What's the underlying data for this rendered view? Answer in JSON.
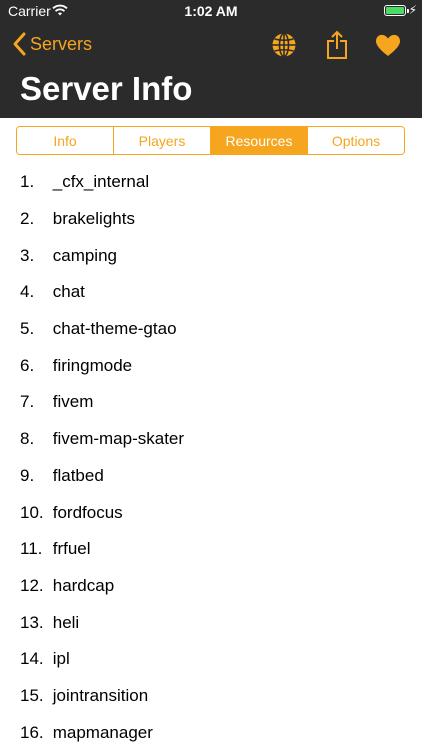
{
  "status_bar": {
    "carrier": "Carrier",
    "time": "1:02 AM",
    "battery_level_fraction": 1.0
  },
  "nav": {
    "back_label": "Servers",
    "title": "Server Info",
    "icons": [
      "globe-icon",
      "share-icon",
      "heart-icon"
    ]
  },
  "colors": {
    "accent": "#f5a51e",
    "bar_bg": "#2b2b2b",
    "text": "#000000",
    "battery": "#4cd964"
  },
  "tabs": [
    {
      "label": "Info",
      "active": false
    },
    {
      "label": "Players",
      "active": false
    },
    {
      "label": "Resources",
      "active": true
    },
    {
      "label": "Options",
      "active": false
    }
  ],
  "resources": [
    {
      "num": "1.",
      "name": "_cfx_internal"
    },
    {
      "num": "2.",
      "name": "brakelights"
    },
    {
      "num": "3.",
      "name": "camping"
    },
    {
      "num": "4.",
      "name": "chat"
    },
    {
      "num": "5.",
      "name": "chat-theme-gtao"
    },
    {
      "num": "6.",
      "name": "firingmode"
    },
    {
      "num": "7.",
      "name": "fivem"
    },
    {
      "num": "8.",
      "name": "fivem-map-skater"
    },
    {
      "num": "9.",
      "name": "flatbed"
    },
    {
      "num": "10.",
      "name": "fordfocus"
    },
    {
      "num": "11.",
      "name": "frfuel"
    },
    {
      "num": "12.",
      "name": "hardcap"
    },
    {
      "num": "13.",
      "name": "heli"
    },
    {
      "num": "14.",
      "name": "ipl"
    },
    {
      "num": "15.",
      "name": "jointransition"
    },
    {
      "num": "16.",
      "name": "mapmanager"
    }
  ]
}
